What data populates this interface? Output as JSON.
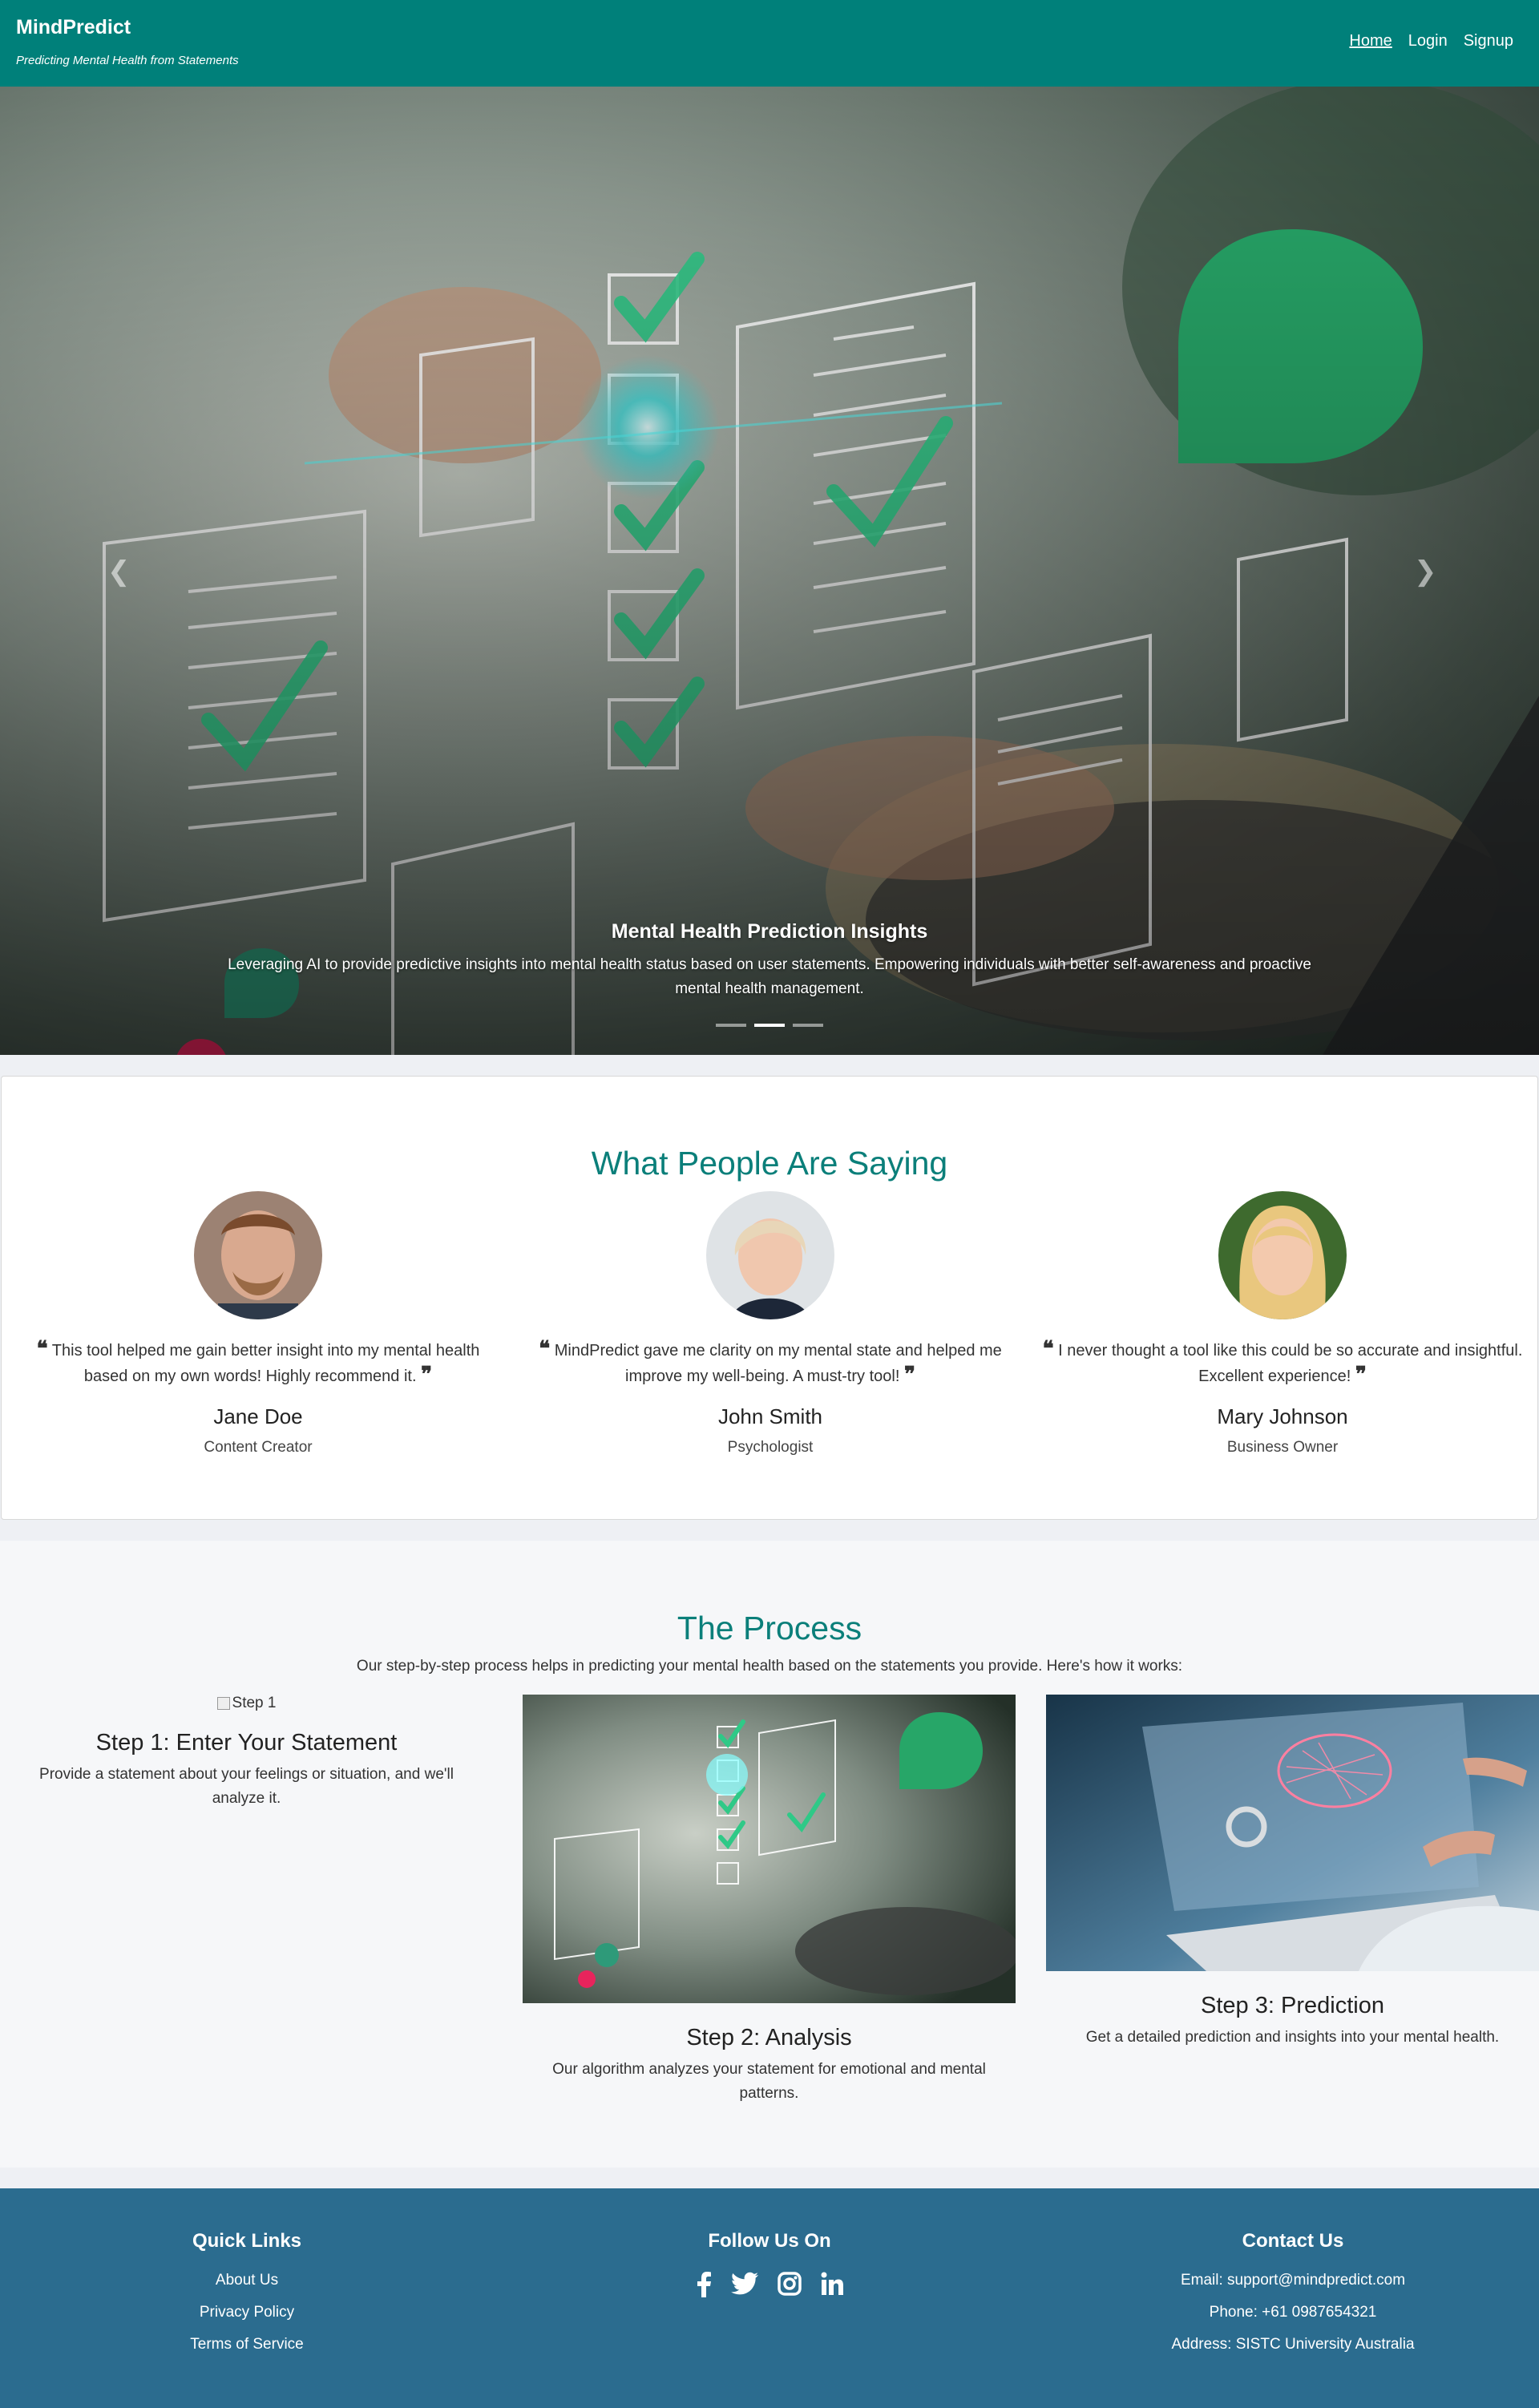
{
  "navbar": {
    "brand": "MindPredict",
    "tagline": "Predicting Mental Health from Statements",
    "links": [
      "Home",
      "Login",
      "Signup"
    ],
    "active": "Home",
    "bg_color": "#00807a"
  },
  "hero": {
    "caption_title": "Mental Health Prediction Insights",
    "caption_text": "Leveraging AI to provide predictive insights into mental health status based on user statements. Empowering individuals with better self-awareness and proactive mental health management.",
    "prev_icon": "chevron-left-icon",
    "next_icon": "chevron-right-icon",
    "indicators": 3,
    "active_indicator": 2
  },
  "testimonials": {
    "title": "What People Are Saying",
    "items": [
      {
        "quote": "This tool helped me gain better insight into my mental health based on my own words! Highly recommend it.",
        "name": "Jane Doe",
        "role": "Content Creator"
      },
      {
        "quote": "MindPredict gave me clarity on my mental state and helped me improve my well-being. A must-try tool!",
        "name": "John Smith",
        "role": "Psychologist"
      },
      {
        "quote": "I never thought a tool like this could be so accurate and insightful. Excellent experience!",
        "name": "Mary Johnson",
        "role": "Business Owner"
      }
    ]
  },
  "process": {
    "title": "The Process",
    "subtitle": "Our step-by-step process helps in predicting your mental health based on the statements you provide. Here's how it works:",
    "steps": [
      {
        "alt": "Step 1",
        "title": "Step 1: Enter Your Statement",
        "text": "Provide a statement about your feelings or situation, and we'll analyze it."
      },
      {
        "title": "Step 2: Analysis",
        "text": "Our algorithm analyzes your statement for emotional and mental patterns."
      },
      {
        "title": "Step 3: Prediction",
        "text": "Get a detailed prediction and insights into your mental health."
      }
    ]
  },
  "footer": {
    "quick_links_title": "Quick Links",
    "quick_links": [
      "About Us",
      "Privacy Policy",
      "Terms of Service"
    ],
    "follow_title": "Follow Us On",
    "social_icons": [
      "facebook-icon",
      "twitter-icon",
      "instagram-icon",
      "linkedin-icon"
    ],
    "contact_title": "Contact Us",
    "contact": [
      "Email: support@mindpredict.com",
      "Phone: +61 0987654321",
      "Address: SISTC University Australia"
    ],
    "bg_color": "#2b6c8f"
  }
}
